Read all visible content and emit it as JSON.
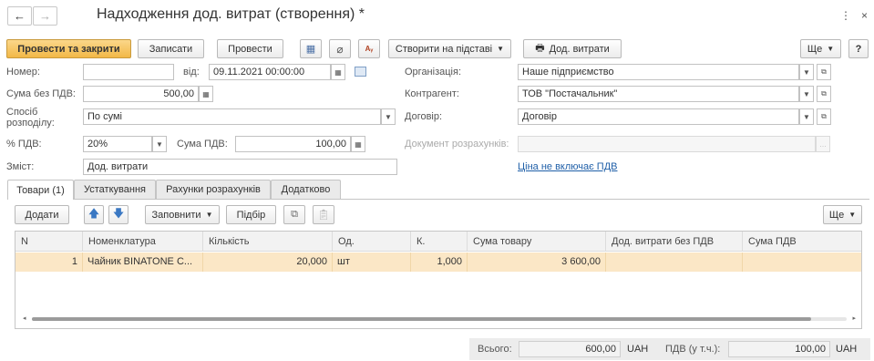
{
  "window": {
    "title": "Надходження дод. витрат (створення) *",
    "back_icon": "←",
    "forward_icon": "→",
    "menu_icon": "⋮",
    "close_icon": "×"
  },
  "toolbar": {
    "post_and_close": "Провести та закрити",
    "save": "Записати",
    "post": "Провести",
    "create_based_on": "Створити на підставі",
    "extra_costs": "Дод. витрати",
    "more": "Ще",
    "help": "?"
  },
  "form": {
    "number_label": "Номер:",
    "number_value": "",
    "date_label": "від:",
    "date_value": "09.11.2021 00:00:00",
    "organization_label": "Організація:",
    "organization_value": "Наше підприємство",
    "amount_label": "Сума без ПДВ:",
    "amount_value": "500,00",
    "counterparty_label": "Контрагент:",
    "counterparty_value": "ТОВ \"Постачальник\"",
    "distribution_label_1": "Спосіб",
    "distribution_label_2": "розподілу:",
    "distribution_value": "По сумі",
    "contract_label": "Договір:",
    "contract_value": "Договір",
    "vat_rate_label": "% ПДВ:",
    "vat_rate_value": "20%",
    "vat_amount_label": "Сума ПДВ:",
    "vat_amount_value": "100,00",
    "settlement_doc_label": "Документ розрахунків:",
    "settlement_doc_value": "",
    "content_label": "Зміст:",
    "content_value": "Дод. витрати",
    "price_link": "Ціна не включає ПДВ"
  },
  "tabs": [
    {
      "label": "Товари (1)",
      "active": true
    },
    {
      "label": "Устаткування",
      "active": false
    },
    {
      "label": "Рахунки розрахунків",
      "active": false
    },
    {
      "label": "Додатково",
      "active": false
    }
  ],
  "table_toolbar": {
    "add": "Додати",
    "fill": "Заповнити",
    "pick": "Підбір",
    "more": "Ще"
  },
  "table": {
    "columns": [
      "N",
      "Номенклатура",
      "Кількість",
      "Од.",
      "К.",
      "Сума товару",
      "Дод. витрати без ПДВ",
      "Сума ПДВ"
    ],
    "rows": [
      [
        "1",
        "Чайник BINATONE C...",
        "20,000",
        "шт",
        "1,000",
        "3 600,00",
        "",
        ""
      ]
    ]
  },
  "footer": {
    "total_label": "Всього:",
    "total_value": "600,00",
    "total_currency": "UAH",
    "vat_label": "ПДВ (у т.ч.):",
    "vat_value": "100,00",
    "vat_currency": "UAH"
  },
  "colors": {
    "primary_button": "#f2b847",
    "selected_row": "#fbe7c6",
    "link": "#1f5fa8"
  }
}
